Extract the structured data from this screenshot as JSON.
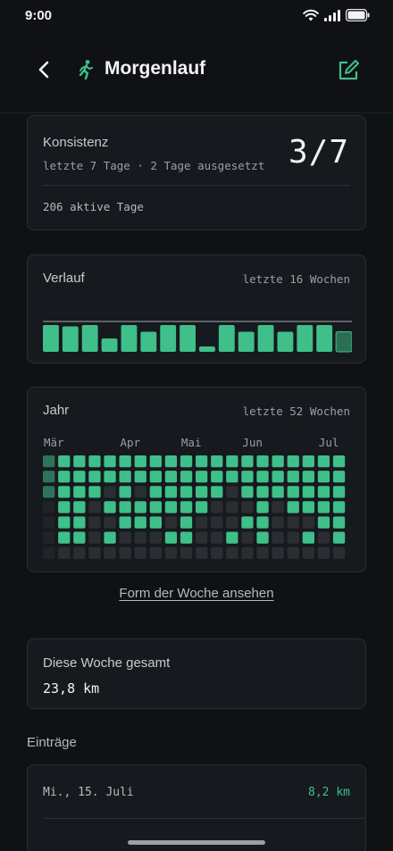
{
  "status_bar": {
    "time": "9:00",
    "icons": [
      "wifi-icon",
      "signal-icon",
      "battery-icon"
    ]
  },
  "nav": {
    "title": "Morgenlauf",
    "back_icon": "chevron-left-icon",
    "habit_icon": "running-person-icon",
    "edit_icon": "edit-icon"
  },
  "colors": {
    "accent": "#3fbf8a",
    "accent_dim": "#2a6f55",
    "cell_off": "#2a2e33",
    "background": "#0f1114",
    "card": "#16191d"
  },
  "consistency": {
    "label": "Konsistenz",
    "subtitle": "letzte 7 Tage · 2 Tage ausgesetzt",
    "ratio": "3/7",
    "active_days": "206 aktive Tage"
  },
  "verlauf": {
    "title": "Verlauf",
    "range": "letzte 16 Wochen",
    "weekly_completion": [
      1,
      0.95,
      1,
      0.5,
      1,
      0.75,
      1,
      1,
      0.2,
      1,
      0.75,
      1,
      0.75,
      1,
      1,
      0.75
    ],
    "current_week_index": 15
  },
  "jahr": {
    "title": "Jahr",
    "range": "letzte 52 Wochen",
    "months": [
      {
        "label": "Mär",
        "week": 0
      },
      {
        "label": "Apr",
        "week": 5
      },
      {
        "label": "Mai",
        "week": 9
      },
      {
        "label": "Jun",
        "week": 13
      },
      {
        "label": "Jul",
        "week": 18
      }
    ],
    "weeks_visible": 20,
    "grid": [
      "11111111111111111111",
      "11111111111111111111",
      "11110101111101111111",
      "01101111111000101111",
      "01100111010001100011",
      "01101000110010100101",
      "00000000000000000000"
    ]
  },
  "week_link": "Form der Woche ansehen",
  "week_total": {
    "label": "Diese Woche gesamt",
    "value": "23,8 km"
  },
  "entries": {
    "title": "Einträge",
    "items": [
      {
        "date": "Mi., 15. Juli",
        "distance": "8,2 km"
      }
    ]
  }
}
